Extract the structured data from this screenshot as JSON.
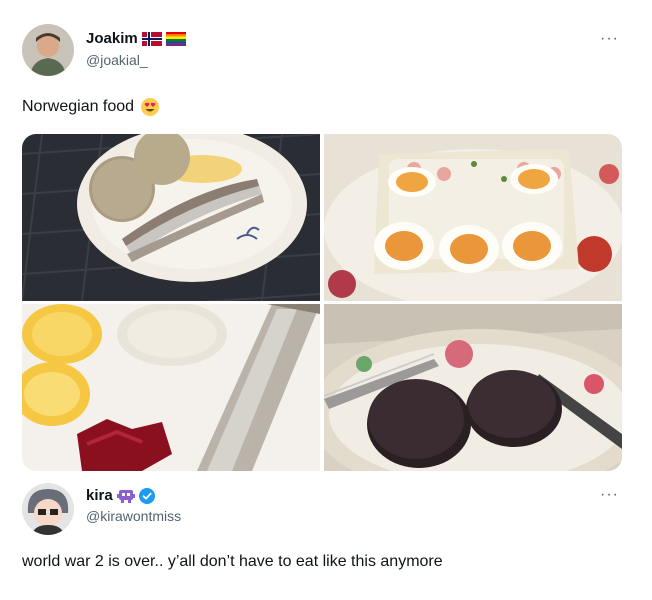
{
  "tweet1": {
    "display_name": "Joakim",
    "handle": "@joakial_",
    "text": "Norwegian food",
    "text_emoji": "heart-eyes-emoji",
    "more": "···",
    "badges": [
      "norway-flag-icon",
      "rainbow-flag-icon"
    ]
  },
  "tweet2": {
    "display_name": "kira",
    "handle": "@kirawontmiss",
    "text": "world war 2 is over.. y’all don’t have to eat like this anymore",
    "more": "···",
    "badges": [
      "alien-icon",
      "verified-icon"
    ]
  },
  "colors": {
    "verified_blue": "#1d9bf0",
    "secondary_text": "#536471",
    "primary_text": "#0f1419"
  }
}
